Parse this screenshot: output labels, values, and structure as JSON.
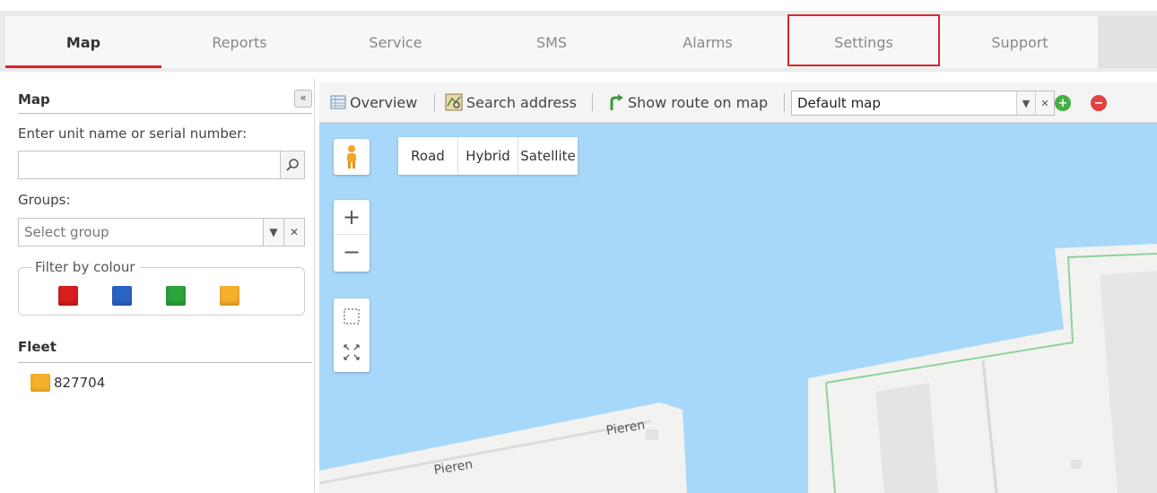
{
  "nav": {
    "tabs": [
      {
        "label": "Map",
        "active": true
      },
      {
        "label": "Reports"
      },
      {
        "label": "Service"
      },
      {
        "label": "SMS"
      },
      {
        "label": "Alarms"
      },
      {
        "label": "Settings",
        "highlighted": true
      },
      {
        "label": "Support"
      }
    ]
  },
  "sidebar": {
    "title": "Map",
    "collapse_glyph": "«",
    "unit_label": "Enter unit name or serial number:",
    "unit_value": "",
    "groups_label": "Groups:",
    "group_placeholder": "Select group",
    "filter_label": "Filter by colour",
    "filter_colors": [
      "#d71f1f",
      "#2b63c4",
      "#2ca33b",
      "#f6b12c"
    ],
    "fleet_title": "Fleet",
    "fleet_items": [
      {
        "label": "827704",
        "color": "#f6b12c"
      }
    ]
  },
  "toolbar": {
    "overview_label": "Overview",
    "search_address_label": "Search address",
    "show_route_label": "Show route on map",
    "map_select_value": "Default map"
  },
  "map": {
    "types": [
      "Road",
      "Hybrid",
      "Satellite"
    ],
    "zoom_in": "+",
    "zoom_out": "−",
    "street_labels": [
      "Pieren",
      "Pieren"
    ],
    "water_color": "#a7d8f9",
    "land_color": "#f2f2f0"
  },
  "colors": {
    "accent": "#d9252a",
    "add": "#43b043",
    "remove": "#e04141"
  }
}
